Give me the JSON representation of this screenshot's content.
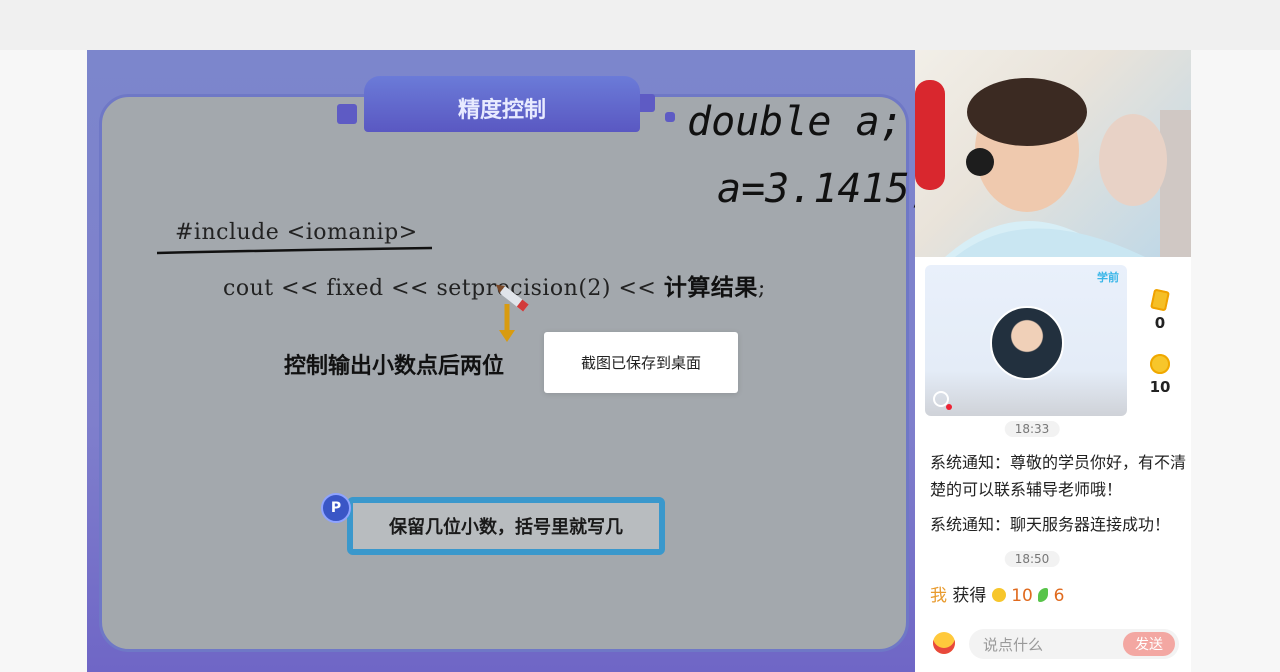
{
  "slide": {
    "title": "精度控制",
    "code_include": "#include <iomanip>",
    "code_cout": "cout << fixed << setprecision(2) <<",
    "code_result": "计算结果",
    "code_semicolon": ";",
    "description": "控制输出小数点后两位",
    "tip": "保留几位小数，括号里就写几",
    "tip_badge": "P",
    "handwriting": [
      "double a;",
      "a=3.1415;"
    ]
  },
  "toast": {
    "message": "截图已保存到桌面"
  },
  "camera": {
    "brand": "学前"
  },
  "stats": {
    "cards": "0",
    "coins": "10"
  },
  "chat": {
    "time1": "18:33",
    "msg1": "系统通知：尊敬的学员你好，有不清楚的可以联系辅导老师哦！",
    "msg2": "系统通知：聊天服务器连接成功！",
    "time2": "18:50",
    "reward_me": "我",
    "reward_text": "获得",
    "reward_coins": "10",
    "reward_leaves": "6"
  },
  "input": {
    "placeholder": "说点什么",
    "send_label": "发送"
  }
}
